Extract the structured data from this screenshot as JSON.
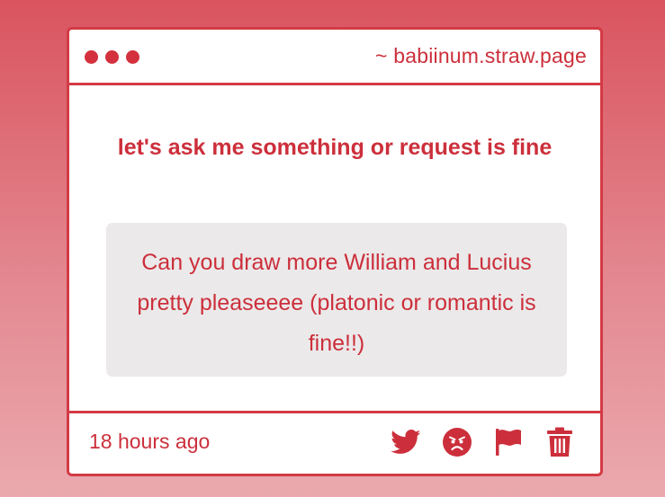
{
  "window": {
    "url": "~ babiinum.straw.page"
  },
  "question": {
    "text": "let's ask me something or request is fine"
  },
  "answer": {
    "text": "Can you draw more William and Lucius pretty pleaseeee (platonic or romantic is fine!!)"
  },
  "footer": {
    "timestamp": "18 hours ago",
    "icons": [
      "twitter-icon",
      "angry-face-icon",
      "flag-icon",
      "trash-icon"
    ]
  },
  "colors": {
    "accent": "#d33a45",
    "text_accent": "#cc2f3b",
    "answer_background": "#ebe9ea",
    "card_background": "#ffffff"
  }
}
